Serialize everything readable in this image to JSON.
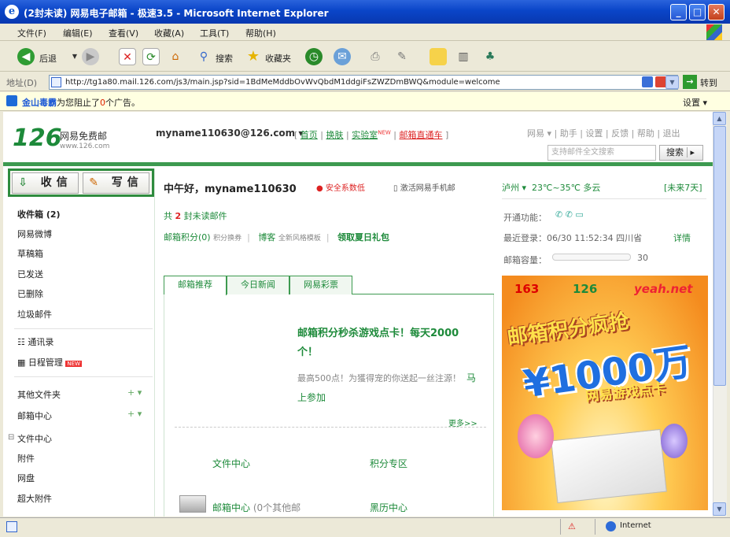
{
  "window": {
    "title": "(2封未读) 网易电子邮箱 - 极速3.5 - Microsoft Internet Explorer"
  },
  "menubar": [
    "文件(F)",
    "编辑(E)",
    "查看(V)",
    "收藏(A)",
    "工具(T)",
    "帮助(H)"
  ],
  "toolbar": {
    "back": "后退",
    "search": "搜索",
    "favorites": "收藏夹"
  },
  "address": {
    "label": "地址(D)",
    "url": "http://tg1a80.mail.126.com/js3/main.jsp?sid=1BdMeMddbOvWvQbdM1ddgiFsZWZDmBWQ&module=welcome",
    "go": "转到"
  },
  "infobar": {
    "brand": "金山毒霸",
    "text_before": "为您阻止了",
    "count": "0",
    "text_after": "个广告。",
    "settings": "设置"
  },
  "header": {
    "logo": "126",
    "logo_caption": "网易免费邮",
    "logo_url": "www.126.com",
    "account": "myname110630@126.com",
    "links": [
      "首页",
      "换肤",
      "实验室",
      "邮箱直通车"
    ],
    "new_badge": "NEW",
    "right_links": [
      "网易",
      "助手",
      "设置",
      "反馈",
      "帮助",
      "退出"
    ],
    "search_placeholder": "支持邮件全文搜索",
    "search_button": "搜索"
  },
  "sidebar": {
    "receive": "收信",
    "compose": "写信",
    "folders": [
      "收件箱 (2)",
      "网易微博",
      "草稿箱",
      "已发送",
      "已删除",
      "垃圾邮件"
    ],
    "contacts": "通讯录",
    "calendar": "日程管理",
    "calendar_badge": "NEW",
    "other_folders": "其他文件夹",
    "mail_center": "邮箱中心",
    "file_center": "文件中心",
    "file_items": [
      "附件",
      "网盘",
      "超大附件"
    ]
  },
  "welcome": {
    "greeting": "中午好，myname110630",
    "security": "安全系数低",
    "activate": "激活网易手机邮",
    "unread_prefix": "共",
    "unread_count": "2",
    "unread_suffix": "封未读邮件",
    "points_label": "邮箱积分(0)",
    "points_exchange": "积分换券",
    "blog_label": "博客",
    "blog_sub": "全新风格模板",
    "birthday": "领取夏日礼包"
  },
  "weather": {
    "city": "泸州",
    "temp": "23℃~35℃ 多云",
    "future": "[未来7天]"
  },
  "account_info": {
    "services_label": "开通功能：",
    "last_login": "最近登录：06/30 11:52:34 四川省",
    "detail": "详情",
    "capacity_label": "邮箱容量：",
    "capacity_value": "30"
  },
  "tabs": [
    "邮箱推荐",
    "今日新闻",
    "网易彩票"
  ],
  "promo": {
    "title": "邮箱积分秒杀游戏点卡！每天2000个！",
    "desc": "最高500点！为獲得宠的你送起一丝注源！",
    "join": "马上参加",
    "more": "更多>>"
  },
  "bottom_links": [
    "文件中心",
    "积分专区",
    "邮箱中心",
    "(0个其他邮",
    "黑历中心"
  ],
  "ad": {
    "logos": [
      "163",
      "126",
      "yeah.net"
    ],
    "headline": "邮箱积分疯抢",
    "amount": "¥1000万",
    "sub": "网易游戏点卡"
  },
  "statusbar": {
    "zone": "Internet"
  }
}
